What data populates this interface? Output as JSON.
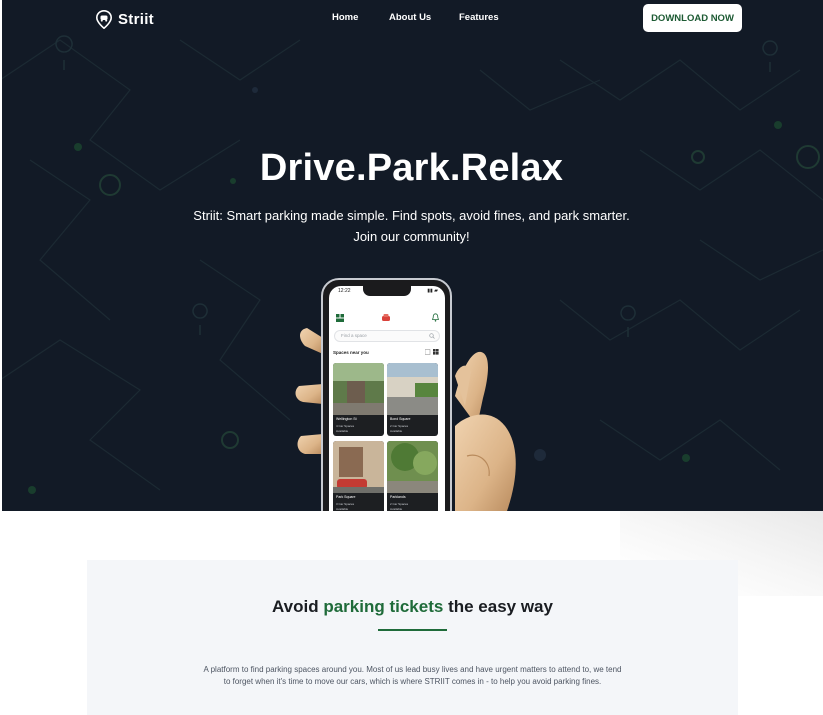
{
  "nav": {
    "brand": "Striit",
    "links": [
      "Home",
      "About Us",
      "Features"
    ],
    "cta": "DOWNLOAD NOW"
  },
  "hero": {
    "title": "Drive.Park.Relax",
    "subtitle_line1": "Striit: Smart parking made simple. Find spots, avoid fines, and park smarter.",
    "subtitle_line2": "Join our community!"
  },
  "phone": {
    "status_time": "12:22",
    "search_placeholder": "Find a space",
    "section_label": "Spaces near you",
    "cards": [
      {
        "name": "Wellington St",
        "meta1": "4 Car Spaces",
        "meta2": "Available"
      },
      {
        "name": "Bond Square",
        "meta1": "2 Car Spaces",
        "meta2": "Available"
      },
      {
        "name": "Park Square",
        "meta1": "3 Car Spaces",
        "meta2": "Available"
      },
      {
        "name": "Parklands",
        "meta1": "2 Car Spaces",
        "meta2": "Available"
      }
    ]
  },
  "section": {
    "title_before": "Avoid ",
    "title_accent": "parking tickets",
    "title_after": " the easy way",
    "desc_line1": "A platform to find parking spaces around you. Most of us lead busy lives and have urgent matters to attend to, we tend",
    "desc_line2": "to forget when it's time to move our cars, which is where STRIIT comes in - to help you avoid parking fines."
  },
  "colors": {
    "hero_bg": "#121a26",
    "accent_green": "#1f6b3a",
    "card_bg": "#f4f6f9"
  },
  "icons": [
    "location-pin-logo-icon",
    "menu-icon",
    "car-logo-icon",
    "bell-icon",
    "search-icon",
    "grid-view-icon"
  ]
}
